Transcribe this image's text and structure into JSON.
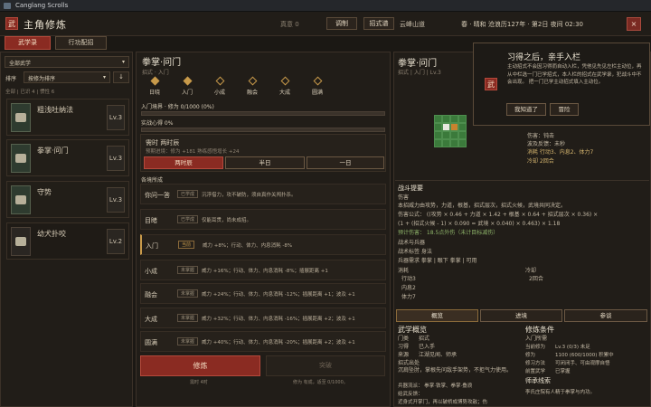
{
  "window": {
    "title": "Canglang Scrolls"
  },
  "header": {
    "seal": "武",
    "title": "主角修炼",
    "zhen_qi": "真意 0",
    "btn_adjust": "调制",
    "btn_stance": "招式谱",
    "location": "云峰山道",
    "datetime": "春 · 晴和  沧浪历127年 · 第2日  夜间 02:30",
    "close": "×"
  },
  "tabs": {
    "martial": "武学录",
    "plan": "行功配招"
  },
  "left": {
    "filter": "全部武学",
    "filter_arrow": "▾",
    "sort_label": "排序",
    "sort_value": "按修为排序",
    "sort_arrow": "▾",
    "order_arrow": "↓",
    "summary": "全部 | 已识 4 | 惯性 6",
    "skills": [
      {
        "name": "粗浅吐纳法",
        "level": "Lv.3"
      },
      {
        "name": "拳掌·问门",
        "level": "Lv.3"
      },
      {
        "name": "守势",
        "level": "Lv.3"
      },
      {
        "name": "幼犬扑咬",
        "level": "Lv.2"
      }
    ]
  },
  "middle": {
    "title": "拳掌·问门",
    "sub": "招式 · 入门",
    "stages": [
      "日晓",
      "入门",
      "小成",
      "融会",
      "大成",
      "圆满"
    ],
    "realm": "入门境界 · 修为 0/1000 (0%)",
    "heart": "实战心得 0%",
    "time_label": "需时 两时辰",
    "time_detail": "预期进境：修为 +181    熟练感悟增长 +24",
    "time_options": [
      "两时辰",
      "半日",
      "一日"
    ],
    "stage_section": "各境所成",
    "rows": [
      {
        "name": "你问一答",
        "badge": "已学成",
        "effect": "沉浮借力，攻不破防，须自真作关闯扑杀。"
      },
      {
        "name": "目睹",
        "badge": "已学成",
        "effect": "仅能耳贯，尚未成招。"
      },
      {
        "name": "入门",
        "badge": "当前",
        "effect": "威力 +8%；行动、体力、内息消耗 -8%"
      },
      {
        "name": "小成",
        "badge": "未掌握",
        "effect": "威力 +16%；行动、体力、内息消耗 -8%；插展距离 +1"
      },
      {
        "name": "融会",
        "badge": "未掌握",
        "effect": "威力 +24%；行动、体力、内息消耗 -12%；插展距离 +1；波及 +1"
      },
      {
        "name": "大成",
        "badge": "未掌握",
        "effect": "威力 +32%；行动、体力、内息消耗 -16%；插展距离 +2；波及 +1"
      },
      {
        "name": "圆满",
        "badge": "未掌握",
        "effect": "威力 +40%；行动、体力、内息消耗 -20%；插展距离 +2；波及 +1"
      }
    ],
    "btn_train": "修炼",
    "btn_break": "突破",
    "note_left": "需时 4时",
    "note_right": "修为 有成，适至 0/1000。"
  },
  "right": {
    "title": "拳掌·问门",
    "sub": "招式 | 入门 | Lv.3",
    "side_info": [
      "范围：单体",
      "攻击：近身",
      "伤害：钝击",
      "波及反馈：未秒"
    ],
    "consume": "消耗  行动3、内息2、体力7",
    "cooldown": "冷却  2回合",
    "tactic_title": "战斗提要",
    "damage_label": "伤害",
    "desc1": "本招威力由攻势，力道，根基，招式层次，招式火候，武境共同决定。",
    "formula1": "伤害公式： ((攻势 × 0.46 + 力道 × 1.42 + 根基 × 0.64 + 招式层次 × 0.36) ×",
    "formula2": "(1 + (招式火候 - 1) × 0.090 = 武境 × 0.040) × 0.463) × 1.18",
    "predict": "预计伤害： 18.5点外伤（未计目标减伤）",
    "req_title": "战术与兵器",
    "req_line1": "战术标签 身法",
    "req_line2": "兵器需求 拳掌 | 眼下 拳掌 | 可用",
    "cost_title": "消耗",
    "cost_items": [
      "行动3",
      "内息2",
      "体力7"
    ],
    "cd_title": "冷却",
    "cd_value": "2回合",
    "subtabs": [
      "概览",
      "进境",
      "参谈"
    ],
    "overview_title": "武学概览",
    "ov_rows": [
      [
        "门类",
        "招式"
      ],
      [
        "习得",
        "已入手"
      ],
      [
        "来源",
        "江湖见闻、师承"
      ],
      [
        "招式出处",
        ""
      ]
    ],
    "ov_desc": "沉肩坠肘，掌根先问敌手架势，不拒气力使用。",
    "ov_weapons": "兵器流派：  拳掌·铁掌、拳掌·叠浪",
    "ov_feedback": "给武反馈：",
    "ov_last": "近身式开掌门，再以破桥成博势攻敌；伤",
    "cond_title": "修炼条件",
    "cond_sub": "入门所需",
    "cond_rows": [
      [
        "当前修为",
        "Lv.3 (0/3) 未足"
      ],
      [
        "修为",
        "1100 (600/1000) 积累中"
      ],
      [
        "修习方法",
        "可闭闭手、可由观摩自悟"
      ],
      [
        "前置武学",
        "已掌握"
      ],
      [
        "师承线索",
        ""
      ]
    ],
    "cond_last": "李氏庄院有人精于拳掌与内功。"
  },
  "tooltip": {
    "seal": "武",
    "title": "习得之后，亲手入栏",
    "body": "主动招式不会因习得而自动入栏，凭他见先见左栏主动位，再从中栏选一门已学招式，本人栏的招式在武学录，犯战斗中不会出现。 把一门已学主动招式填入主动位。",
    "btn_ok": "我知道了",
    "btn_skip": "冒险"
  },
  "colors": {
    "accent": "#8a2b22",
    "gold": "#c89a4a",
    "panel": "#211d18"
  }
}
